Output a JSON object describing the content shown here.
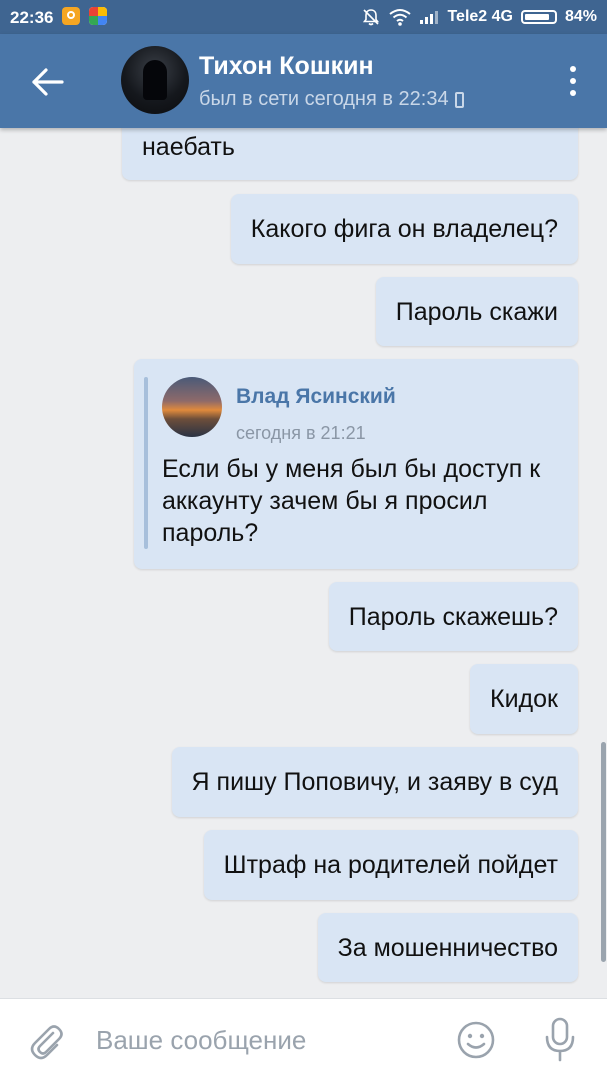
{
  "status_bar": {
    "time": "22:36",
    "carrier": "Tele2 4G",
    "battery": "84%"
  },
  "header": {
    "back_icon": "arrow-left-icon",
    "contact_name": "Тихон Кошкин",
    "contact_status": "был в сети сегодня в 22:34",
    "menu_icon": "more-vertical-icon"
  },
  "messages": [
    {
      "text": "наебать"
    },
    {
      "text": "Какого фига он владелец?"
    },
    {
      "text": "Пароль скажи"
    },
    {
      "forwarded": {
        "author": "Влад Ясинский",
        "time": "сегодня в 21:21",
        "text": "Если бы у меня был бы доступ к аккаунту зачем бы я просил пароль?"
      }
    },
    {
      "text": "Пароль скажешь?"
    },
    {
      "text": "Кидок"
    },
    {
      "text": "Я пишу Поповичу, и заяву в суд"
    },
    {
      "text": "Штраф на родителей пойдет"
    },
    {
      "text": "За мошенничество"
    }
  ],
  "composer": {
    "placeholder": "Ваше сообщение",
    "value": "",
    "attach_icon": "paperclip-icon",
    "emoji_icon": "smile-icon",
    "mic_icon": "microphone-icon"
  },
  "colors": {
    "header": "#4a76a8",
    "status_bar": "#3f6591",
    "bubble": "#d9e5f4",
    "background": "#edeef0",
    "link": "#4a76a8"
  }
}
